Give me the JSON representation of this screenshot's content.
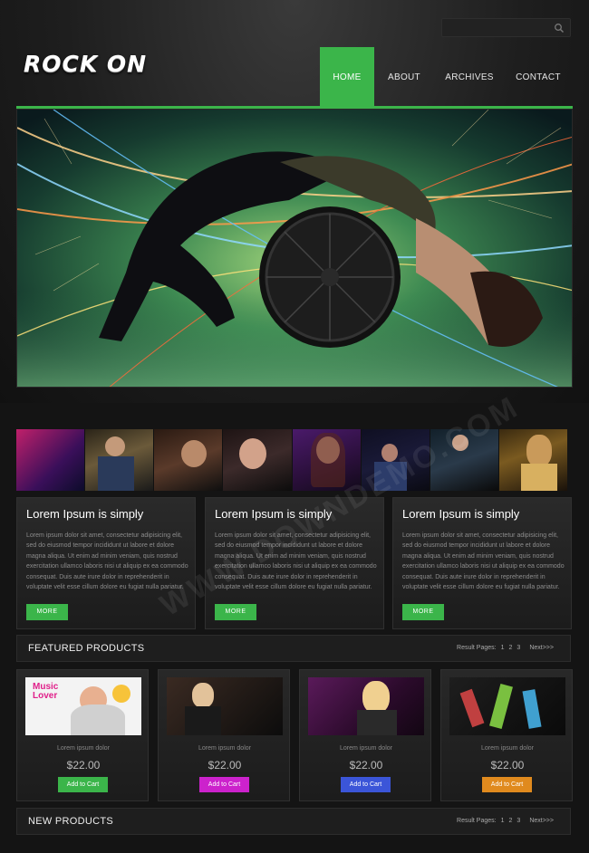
{
  "brand": {
    "logo_text": "ROCK ON"
  },
  "search": {
    "placeholder": "",
    "icon": "search-icon"
  },
  "nav": {
    "items": [
      {
        "label": "HOME",
        "active": true
      },
      {
        "label": "ABOUT",
        "active": false
      },
      {
        "label": "ARCHIVES",
        "active": false
      },
      {
        "label": "CONTACT",
        "active": false
      }
    ]
  },
  "colors": {
    "accent": "#3bb54a",
    "background": "#141414",
    "magenta": "#cc22cc",
    "blue": "#3b55d8",
    "orange": "#e08a1e"
  },
  "features": [
    {
      "title": "Lorem Ipsum is simply",
      "body": "Lorem ipsum dolor sit amet, consectetur adipisicing elit, sed do eiusmod tempor incididunt ut labore et dolore magna aliqua. Ut enim ad minim veniam, quis nostrud exercitation ullamco laboris nisi ut aliquip ex ea commodo consequat. Duis aute irure dolor in reprehenderit in voluptate velit esse cillum dolore eu fugiat nulla pariatur.",
      "button": "MORE"
    },
    {
      "title": "Lorem Ipsum is simply",
      "body": "Lorem ipsum dolor sit amet, consectetur adipisicing elit, sed do eiusmod tempor incididunt ut labore et dolore magna aliqua. Ut enim ad minim veniam, quis nostrud exercitation ullamco laboris nisi ut aliquip ex ea commodo consequat. Duis aute irure dolor in reprehenderit in voluptate velit esse cillum dolore eu fugiat nulla pariatur.",
      "button": "MORE"
    },
    {
      "title": "Lorem Ipsum is simply",
      "body": "Lorem ipsum dolor sit amet, consectetur adipisicing elit, sed do eiusmod tempor incididunt ut labore et dolore magna aliqua. Ut enim ad minim veniam, quis nostrud exercitation ullamco laboris nisi ut aliquip ex ea commodo consequat. Duis aute irure dolor in reprehenderit in voluptate velit esse cillum dolore eu fugiat nulla pariatur.",
      "button": "MORE"
    }
  ],
  "featured": {
    "title": "FEATURED PRODUCTS",
    "pager_label": "Result Pages:",
    "pages": [
      "1",
      "2",
      "3"
    ],
    "next": "Next>>>"
  },
  "products": [
    {
      "name": "Lorem ipsum dolor",
      "price": "$22.00",
      "button": "Add to Cart",
      "button_color": "#3bb54a",
      "image_text": "Music Lover"
    },
    {
      "name": "Lorem ipsum dolor",
      "price": "$22.00",
      "button": "Add to Cart",
      "button_color": "#cc22cc"
    },
    {
      "name": "Lorem ipsum dolor",
      "price": "$22.00",
      "button": "Add to Cart",
      "button_color": "#3b55d8"
    },
    {
      "name": "Lorem ipsum dolor",
      "price": "$22.00",
      "button": "Add to Cart",
      "button_color": "#e08a1e"
    }
  ],
  "new_products": {
    "title": "NEW PRODUCTS",
    "pager_label": "Result Pages:",
    "pages": [
      "1",
      "2",
      "3"
    ],
    "next": "Next>>>"
  },
  "watermark": "WWW.DOWNDEMO.COM"
}
